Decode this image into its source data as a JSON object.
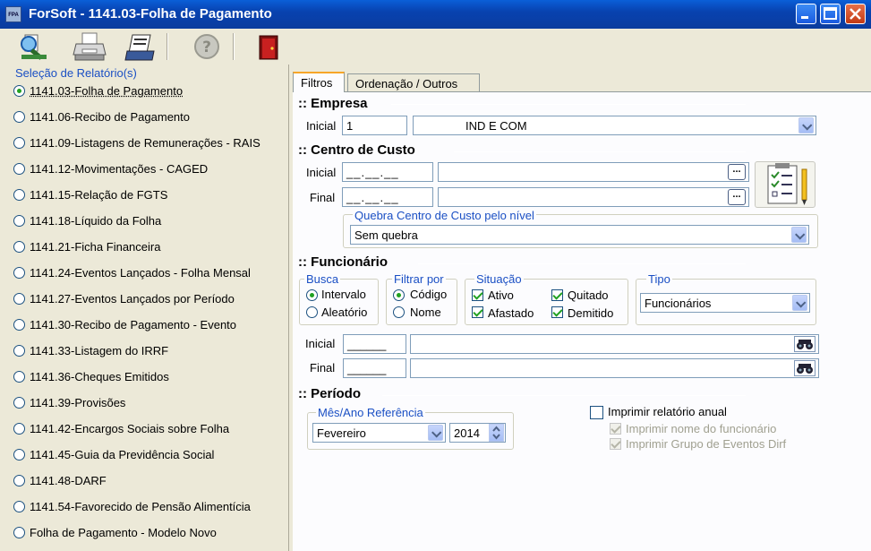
{
  "window": {
    "app_icon": "FPA",
    "title": "ForSoft - 1141.03-Folha de Pagamento",
    "controls": [
      "minimize-icon",
      "maximize-icon",
      "close-icon"
    ]
  },
  "toolbar": {
    "buttons": [
      "preview-icon",
      "printer-icon",
      "print-setup-icon",
      "help-icon",
      "exit-door-icon"
    ]
  },
  "left_panel": {
    "title": "Seleção de Relatório(s)",
    "items": [
      {
        "label": "1141.03-Folha de Pagamento",
        "selected": true
      },
      {
        "label": "1141.06-Recibo de Pagamento",
        "selected": false
      },
      {
        "label": "1141.09-Listagens de Remunerações - RAIS",
        "selected": false
      },
      {
        "label": "1141.12-Movimentações - CAGED",
        "selected": false
      },
      {
        "label": "1141.15-Relação de FGTS",
        "selected": false
      },
      {
        "label": "1141.18-Líquido da Folha",
        "selected": false
      },
      {
        "label": "1141.21-Ficha Financeira",
        "selected": false
      },
      {
        "label": "1141.24-Eventos Lançados - Folha Mensal",
        "selected": false
      },
      {
        "label": "1141.27-Eventos Lançados por Período",
        "selected": false
      },
      {
        "label": "1141.30-Recibo de Pagamento - Evento",
        "selected": false
      },
      {
        "label": "1141.33-Listagem do IRRF",
        "selected": false
      },
      {
        "label": "1141.36-Cheques Emitidos",
        "selected": false
      },
      {
        "label": "1141.39-Provisões",
        "selected": false
      },
      {
        "label": "1141.42-Encargos Sociais sobre Folha",
        "selected": false
      },
      {
        "label": "1141.45-Guia da Previdência Social",
        "selected": false
      },
      {
        "label": "1141.48-DARF",
        "selected": false
      },
      {
        "label": "1141.54-Favorecido de Pensão Alimentícia",
        "selected": false
      },
      {
        "label": "Folha de Pagamento - Modelo Novo",
        "selected": false
      }
    ]
  },
  "tabs": [
    {
      "label": "Filtros",
      "active": true
    },
    {
      "label": "Ordenação / Outros",
      "active": false
    }
  ],
  "empresa": {
    "section": ":: Empresa",
    "label_inicial": "Inicial",
    "code": "1",
    "name": "IND E COM"
  },
  "centro_custo": {
    "section": ":: Centro de Custo",
    "label_inicial": "Inicial",
    "label_final": "Final",
    "inicial_mask": "__.__.__",
    "final_mask": "__.__.__",
    "ellipsis": "...",
    "quebra_title": "Quebra Centro de Custo pelo nível",
    "quebra_value": "Sem quebra"
  },
  "funcionario": {
    "section": ":: Funcionário",
    "busca": {
      "title": "Busca",
      "options": [
        {
          "label": "Intervalo",
          "selected": true
        },
        {
          "label": "Aleatório",
          "selected": false
        }
      ]
    },
    "filtrar": {
      "title": "Filtrar por",
      "options": [
        {
          "label": "Código",
          "selected": true
        },
        {
          "label": "Nome",
          "selected": false
        }
      ]
    },
    "situacao": {
      "title": "Situação",
      "options": [
        {
          "label": "Ativo",
          "checked": true
        },
        {
          "label": "Quitado",
          "checked": true
        },
        {
          "label": "Afastado",
          "checked": true
        },
        {
          "label": "Demitido",
          "checked": true
        }
      ]
    },
    "tipo": {
      "title": "Tipo",
      "value": "Funcionários"
    },
    "label_inicial": "Inicial",
    "label_final": "Final",
    "inicial_code": "______",
    "final_code": "______"
  },
  "periodo": {
    "section": ":: Período",
    "mes_ano_title": "Mês/Ano Referência",
    "month": "Fevereiro",
    "year": "2014",
    "anual": {
      "label": "Imprimir relatório anual",
      "checked": false
    },
    "nome_funcionario": {
      "label": "Imprimir nome do funcionário",
      "checked": true,
      "enabled": false
    },
    "grupo_dirf": {
      "label": "Imprimir Grupo de Eventos Dirf",
      "checked": true,
      "enabled": false
    }
  },
  "colors": {
    "title_bar": "#0a52cc",
    "group_title": "#1a4fc4",
    "check": "#21a121",
    "panel_bg": "#ece9d8"
  }
}
